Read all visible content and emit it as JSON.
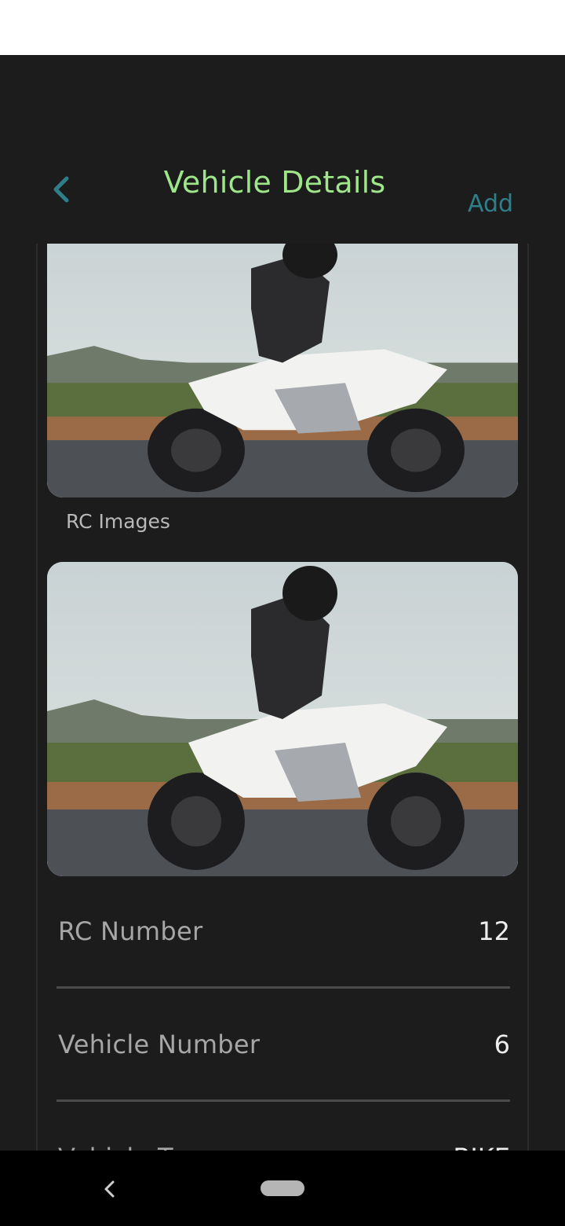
{
  "header": {
    "title": "Vehicle Details",
    "add_label": "Add",
    "back_icon": "chevron-left-icon"
  },
  "sections": {
    "rc_images_label": "RC Images"
  },
  "details": {
    "rc_number": {
      "label": "RC Number",
      "value": "12"
    },
    "vehicle_number": {
      "label": "Vehicle Number",
      "value": "6"
    },
    "vehicle_type": {
      "label": "Vehicle Type",
      "value": "BIKE"
    }
  },
  "colors": {
    "background": "#1c1c1c",
    "title": "#9fe58a",
    "accent": "#2f7f8a",
    "label": "#a6a6a6",
    "value": "#eeeeee"
  },
  "nav": {
    "back_icon": "triangle-back-icon",
    "home_icon": "home-pill-icon"
  }
}
